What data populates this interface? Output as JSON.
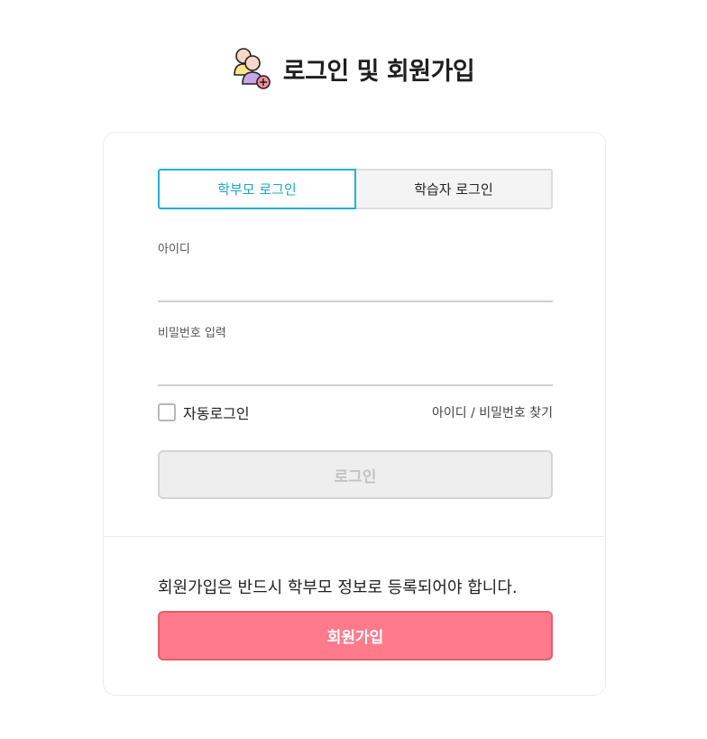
{
  "header": {
    "title": "로그인 및 회원가입",
    "icon": "users-add-icon"
  },
  "tabs": [
    {
      "label": "학부모 로그인",
      "active": true
    },
    {
      "label": "학습자 로그인",
      "active": false
    }
  ],
  "form": {
    "id_label": "아이디",
    "id_value": "",
    "password_label": "비밀번호 입력",
    "password_value": "",
    "autologin_label": "자동로그인",
    "autologin_checked": false,
    "find_link": "아이디 / 비밀번호 찾기",
    "login_button": "로그인"
  },
  "signup": {
    "note": "회원가입은 반드시 학부모 정보로 등록되어야 합니다.",
    "button": "회원가입"
  },
  "colors": {
    "accent": "#1fb3d2",
    "signup": "#ff7a8b",
    "disabled": "#eeeeee"
  }
}
